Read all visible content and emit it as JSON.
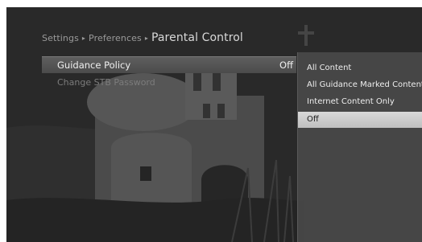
{
  "breadcrumb": {
    "items": [
      "Settings",
      "Preferences"
    ],
    "separator": "▸",
    "current": "Parental Control"
  },
  "menu": {
    "items": [
      {
        "label": "Guidance Policy",
        "value": "Off",
        "state": "selected"
      },
      {
        "label": "Change STB Password",
        "value": "",
        "state": "disabled"
      }
    ]
  },
  "dropdown": {
    "options": [
      "All Content",
      "All Guidance Marked Content",
      "Internet Content Only",
      "Off"
    ],
    "selected_index": 3
  },
  "colors": {
    "highlight": "#d0d0d0",
    "selected_row": "#555555",
    "panel": "#484848"
  }
}
